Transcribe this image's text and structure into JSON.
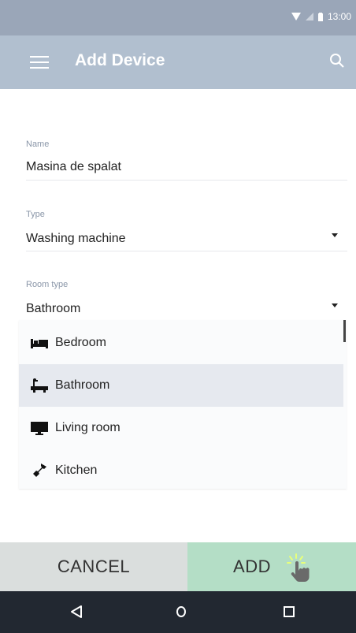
{
  "status_bar": {
    "time": "13:00",
    "icons": [
      "wifi-icon",
      "signal-icon",
      "battery-icon"
    ]
  },
  "app_bar": {
    "title": "Add Device",
    "menu_icon": "menu-icon",
    "search_icon": "search-icon"
  },
  "form": {
    "name": {
      "label": "Name",
      "value": "Masina de spalat"
    },
    "type": {
      "label": "Type",
      "value": "Washing machine"
    },
    "room_type": {
      "label": "Room type",
      "value": "Bathroom"
    }
  },
  "dropdown": {
    "items": [
      {
        "label": "Bedroom",
        "icon": "bed-icon",
        "selected": false
      },
      {
        "label": "Bathroom",
        "icon": "bathtub-icon",
        "selected": true
      },
      {
        "label": "Living room",
        "icon": "tv-icon",
        "selected": false
      },
      {
        "label": "Kitchen",
        "icon": "blender-icon",
        "selected": false
      }
    ]
  },
  "buttons": {
    "cancel": "CANCEL",
    "add": "ADD"
  },
  "nav": {
    "back": "back-icon",
    "home": "home-icon",
    "recents": "recents-icon"
  },
  "colors": {
    "app_bar": "#b1bfcf",
    "status_bar": "#9aa6b8",
    "add_button": "#b4dec6",
    "cancel_button": "#dadedd",
    "nav_bar": "#222831"
  }
}
